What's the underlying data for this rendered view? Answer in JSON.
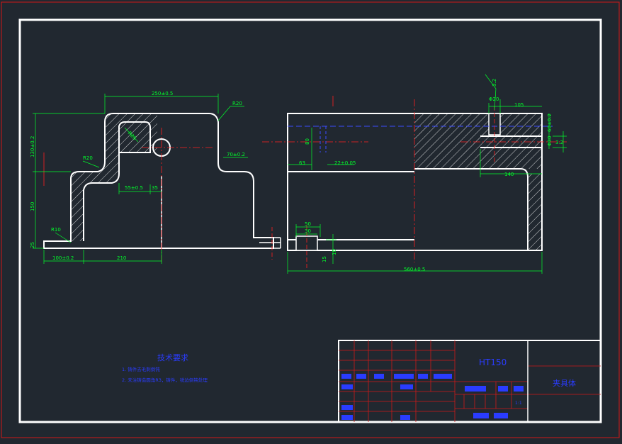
{
  "drawing": {
    "dimensions_front": {
      "top_width": "250±0.5",
      "radius_top_right": "R20",
      "radius_hole": "R25",
      "left_height_top": "130±0.2",
      "radius_left": "R20",
      "slot_width": "55±0.5",
      "slot_offset": "35",
      "right_step": "70±0.2",
      "left_height_mid": "150",
      "radius_bottom": "R10",
      "base_height": "25",
      "base_left_width": "100±0.2",
      "base_right_width": "210"
    },
    "dimensions_side": {
      "angle_top": "3.2",
      "hole_dia": "Φ20",
      "right_width": "105",
      "depth_80": "80",
      "offset_63": "63",
      "offset_22": "22±0.05",
      "dia_30": "Φ30",
      "tol_60": "60±0.2",
      "angle_right": "3.2",
      "width_140": "140",
      "slot_50": "50",
      "slot_30": "30",
      "height_15": "15",
      "height_10": "10",
      "total_width": "560±0.5"
    },
    "tech_requirements": {
      "title": "技术要求",
      "items": [
        "1. 铸件去毛刺倒钝",
        "2. 未注铸造圆角R3，铸件，锐边倒钝处理"
      ]
    },
    "title_block": {
      "material": "HT150",
      "part_name": "夹具体",
      "scale": "1:1",
      "ratio_label": "比例",
      "weight_label": "重量"
    }
  }
}
